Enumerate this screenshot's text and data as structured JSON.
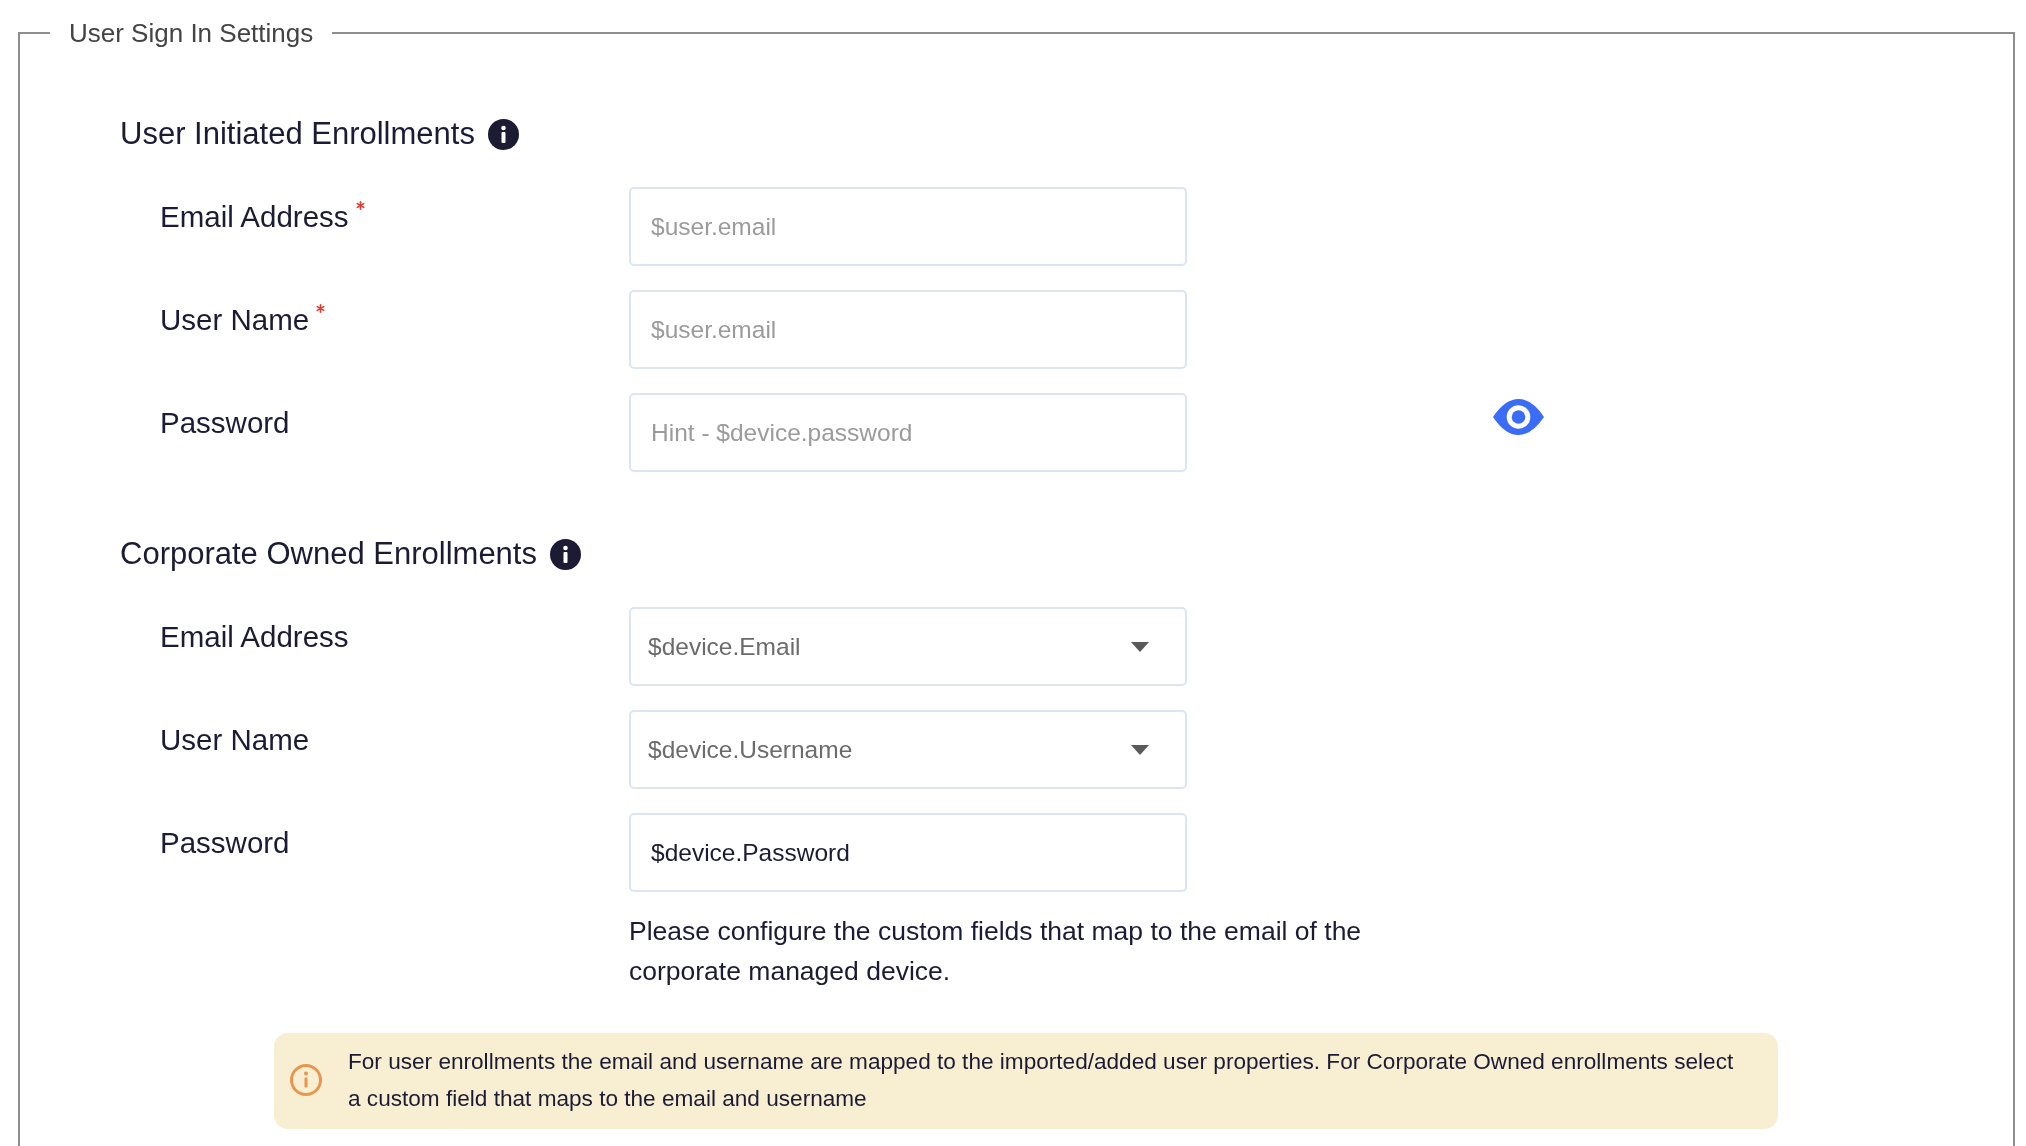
{
  "settings": {
    "legend": "User Sign In Settings",
    "sections": [
      {
        "title": "User Initiated Enrollments",
        "fields": [
          {
            "kind": "text",
            "label": "Email Address",
            "required": true,
            "placeholder": "$user.email"
          },
          {
            "kind": "text",
            "label": "User Name",
            "required": true,
            "placeholder": "$user.email"
          },
          {
            "kind": "password",
            "label": "Password",
            "required": false,
            "placeholder": "Hint - $device.password"
          }
        ]
      },
      {
        "title": "Corporate Owned Enrollments",
        "fields": [
          {
            "kind": "select",
            "label": "Email Address",
            "required": false,
            "value": "$device.Email"
          },
          {
            "kind": "select",
            "label": "User Name",
            "required": false,
            "value": "$device.Username"
          },
          {
            "kind": "text",
            "label": "Password",
            "required": false,
            "value": "$device.Password"
          }
        ],
        "help_text": "Please configure the custom fields that map to the email of the corporate managed device."
      }
    ],
    "notice": {
      "text": "For user enrollments the email and username are mapped to the imported/added user properties. For Corporate Owned enrollments select a custom field that maps to the email and username"
    }
  }
}
